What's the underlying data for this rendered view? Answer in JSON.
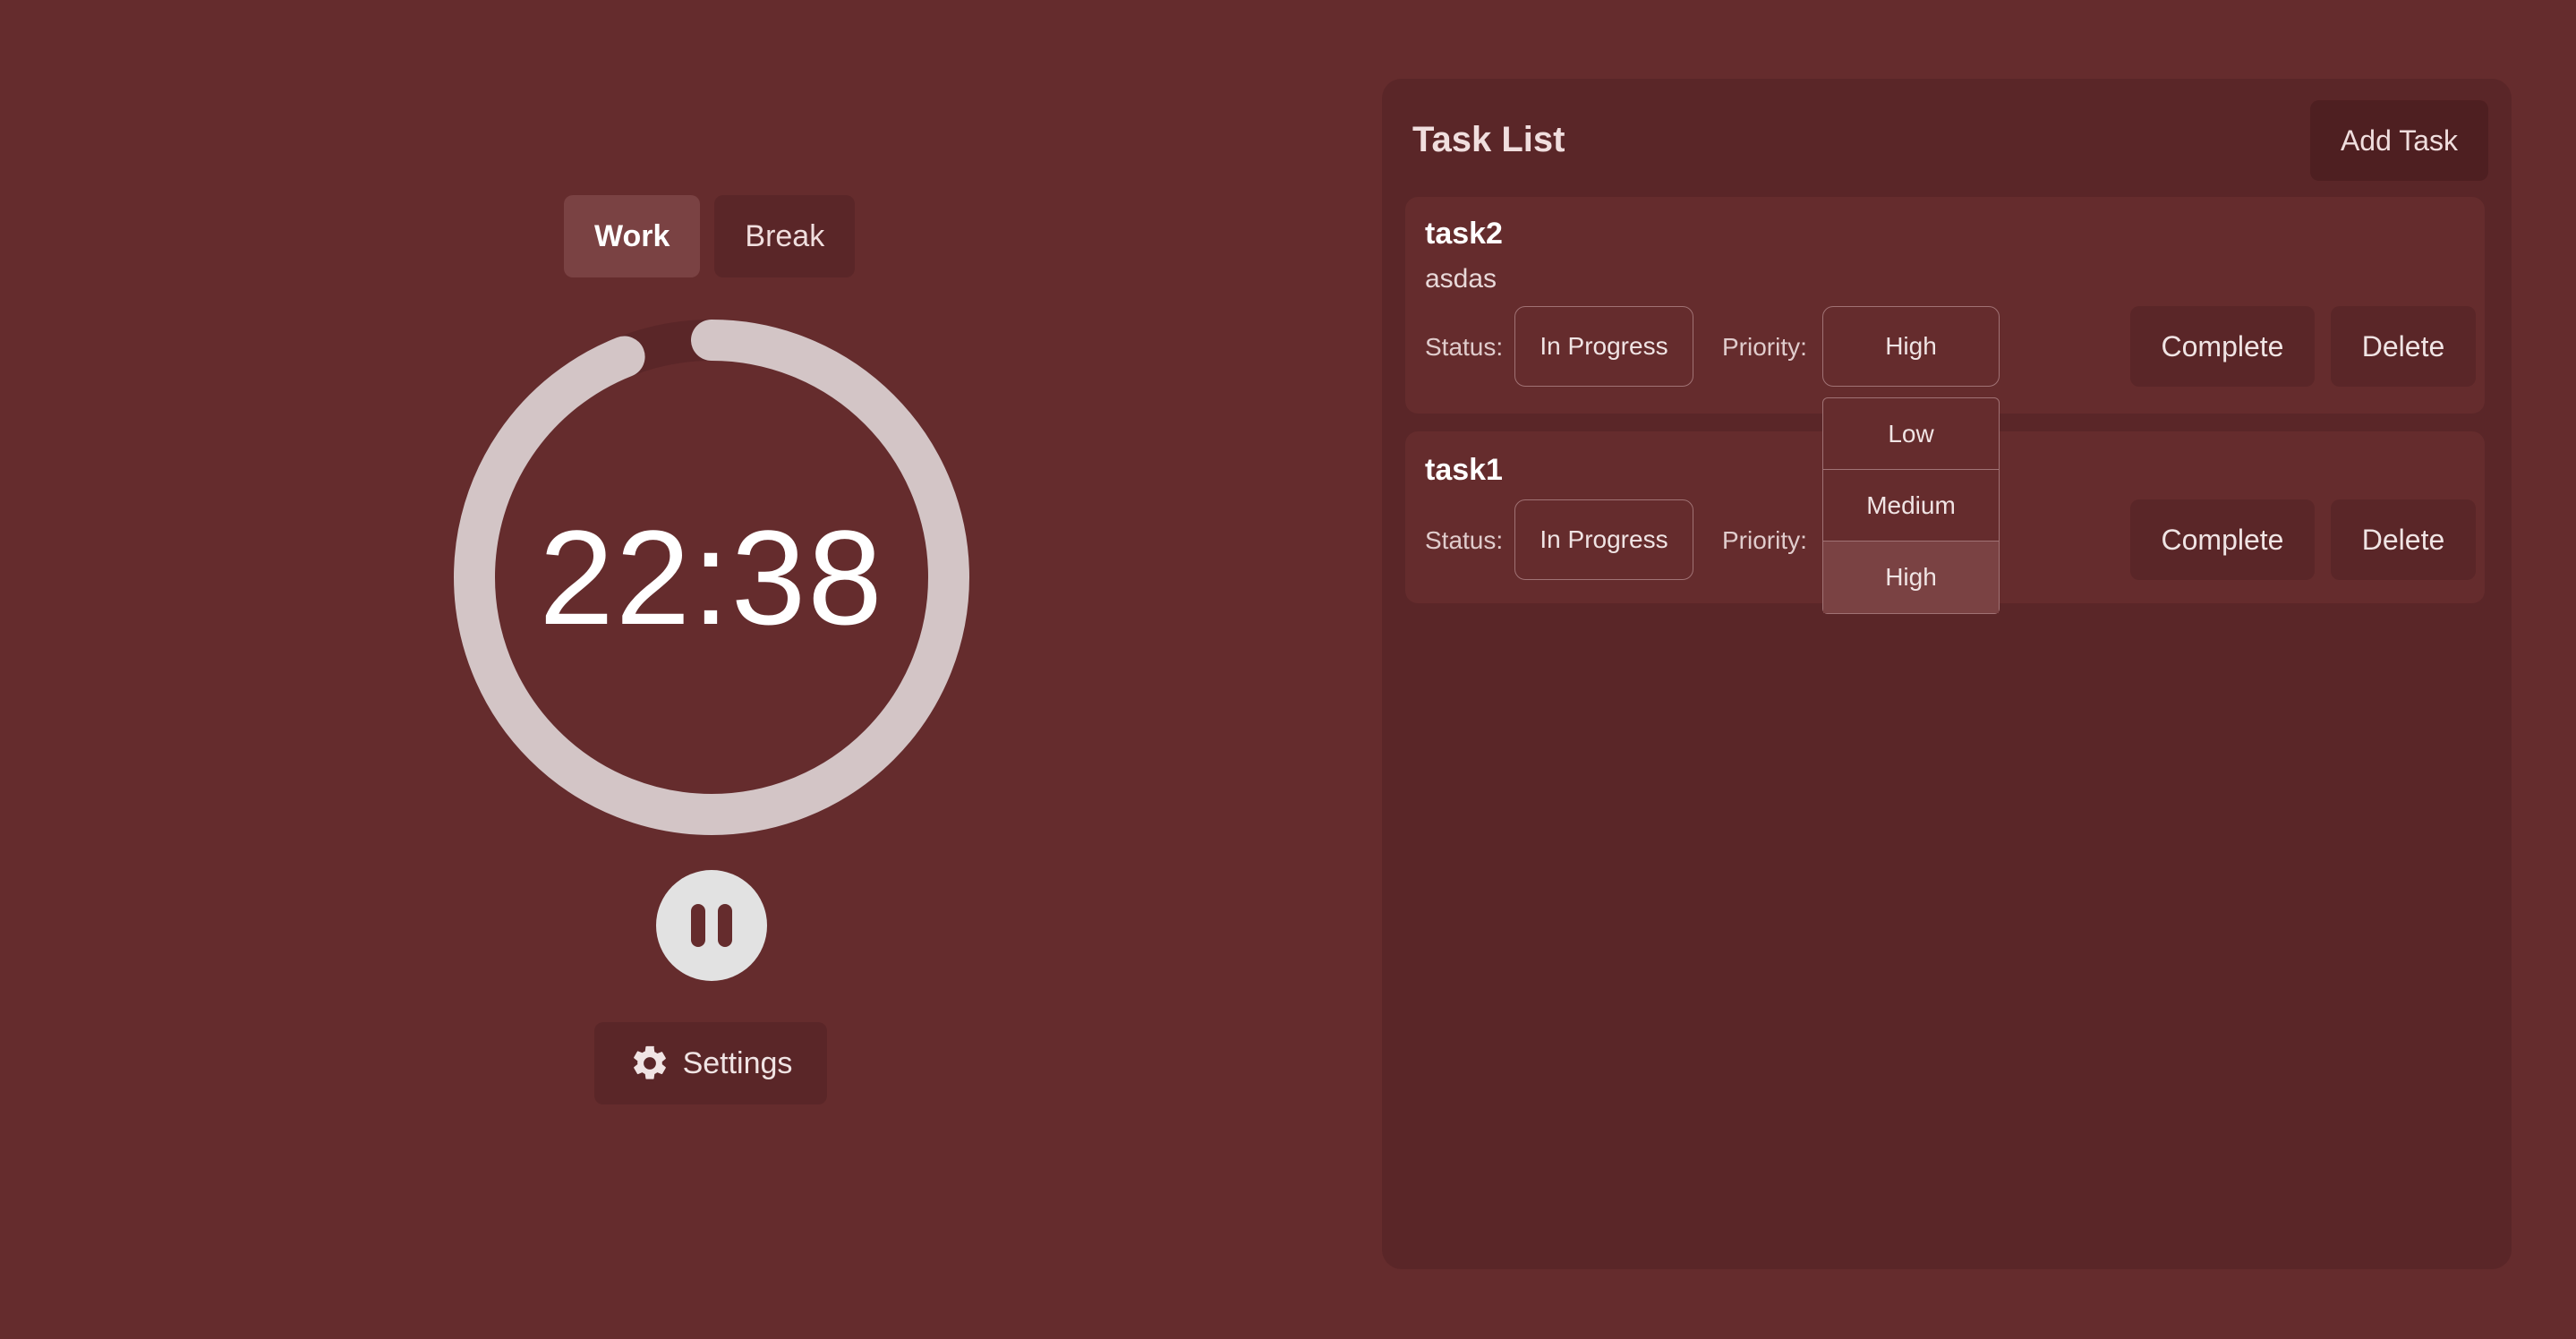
{
  "timer": {
    "tabs": [
      {
        "label": "Work",
        "active": true
      },
      {
        "label": "Break",
        "active": false
      }
    ],
    "time_display": "22:38",
    "progress_fraction": 0.94,
    "settings_label": "Settings"
  },
  "task_panel": {
    "title": "Task List",
    "add_task_label": "Add Task",
    "status_label": "Status:",
    "priority_label": "Priority:",
    "complete_label": "Complete",
    "delete_label": "Delete",
    "tasks": [
      {
        "title": "task2",
        "description": "asdas",
        "status": "In Progress",
        "priority": "High"
      },
      {
        "title": "task1",
        "description": "",
        "status": "In Progress",
        "priority": "High"
      }
    ],
    "priority_dropdown": {
      "options": [
        "Low",
        "Medium",
        "High"
      ],
      "selected": "High"
    }
  },
  "colors": {
    "background": "#652c2d",
    "panel": "#5a2628",
    "ring": "#d3c5c6",
    "ring_track": "#5a2628",
    "pause_button": "#e2e2e2"
  },
  "icons": [
    "pause-icon",
    "gear-icon"
  ]
}
